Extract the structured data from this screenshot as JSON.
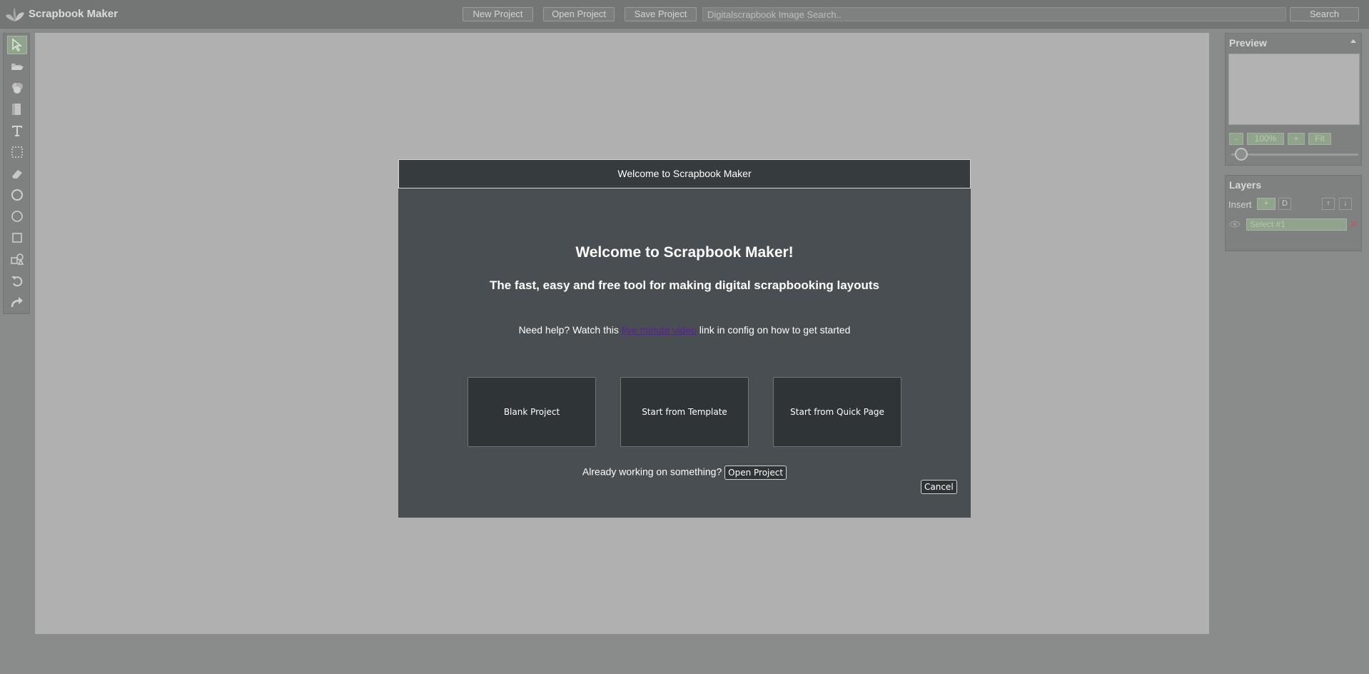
{
  "app": {
    "title": "Scrapbook Maker"
  },
  "topbar": {
    "new_project": "New Project",
    "open_project": "Open Project",
    "save_project": "Save Project",
    "search_placeholder": "Digitalscrapbook Image Search..",
    "search_button": "Search"
  },
  "toolbar": {
    "tools": [
      "select-tool",
      "open-folder-tool",
      "color-fill-tool",
      "paper-tool",
      "text-tool",
      "marquee-select-tool",
      "eraser-tool",
      "circle-tool",
      "circle-outline-tool",
      "rectangle-tool",
      "shapes-tool",
      "undo-tool",
      "redo-tool"
    ],
    "active_tool": "select-tool"
  },
  "preview": {
    "title": "Preview",
    "zoom_out": "-",
    "zoom_level": "100%",
    "zoom_in": "+",
    "fit": "Fit"
  },
  "layers": {
    "title": "Layers",
    "insert_label": "Insert",
    "add_button": "+",
    "duplicate_button": "D",
    "move_up": "↑",
    "move_down": "↓",
    "items": [
      {
        "name": "Select #1"
      }
    ],
    "delete_symbol": "✕"
  },
  "modal": {
    "header": "Welcome to Scrapbook Maker",
    "heading": "Welcome to Scrapbook Maker!",
    "subheading": "The fast, easy and free tool for making digital scrapbooking layouts",
    "help_prefix": "Need help? Watch this ",
    "help_link": "five minute video",
    "help_suffix": " link in config on how to get started",
    "choices": [
      "Blank Project",
      "Start from Template",
      "Start from Quick Page"
    ],
    "already_text": "Already working on something?",
    "open_project": "Open Project",
    "cancel": "Cancel"
  }
}
